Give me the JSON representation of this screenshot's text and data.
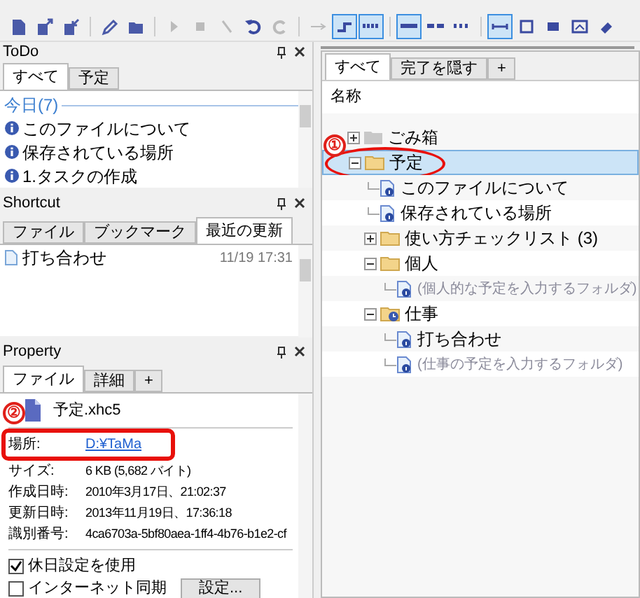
{
  "toolbar": {
    "buttons": [
      {
        "pressed": false
      },
      {
        "pressed": false
      },
      {
        "pressed": false
      },
      {
        "pressed": false
      },
      {
        "pressed": false
      },
      {
        "pressed": false
      },
      {
        "pressed": false
      },
      {
        "pressed": false
      },
      {
        "pressed": false
      },
      {
        "pressed": false
      },
      {
        "pressed": false
      },
      {
        "pressed": true
      },
      {
        "pressed": true
      },
      {
        "pressed": true
      },
      {
        "pressed": false
      },
      {
        "pressed": false
      },
      {
        "pressed": true
      },
      {
        "pressed": false
      },
      {
        "pressed": false
      },
      {
        "pressed": false
      },
      {
        "pressed": false
      }
    ]
  },
  "todo": {
    "title": "ToDo",
    "tabs": [
      {
        "label": "すべて",
        "selected": true
      },
      {
        "label": "予定",
        "selected": false
      }
    ],
    "group": "今日(7)",
    "items": [
      "このファイルについて",
      "保存されている場所",
      "1.タスクの作成"
    ]
  },
  "shortcut": {
    "title": "Shortcut",
    "tabs": [
      {
        "label": "ファイル",
        "selected": false
      },
      {
        "label": "ブックマーク",
        "selected": false
      },
      {
        "label": "最近の更新",
        "selected": true
      }
    ],
    "items": [
      {
        "name": "打ち合わせ",
        "time": "11/19 17:31"
      }
    ]
  },
  "property": {
    "title": "Property",
    "tabs": [
      {
        "label": "ファイル",
        "selected": true
      },
      {
        "label": "詳細",
        "selected": false
      },
      {
        "label": "+",
        "selected": false
      }
    ],
    "file_name": "予定.xhc5",
    "fields": [
      {
        "label": "場所:",
        "value": "D:¥TaMa",
        "kind": "link"
      },
      {
        "label": "サイズ:",
        "value": "6 KB (5,682 バイト)",
        "kind": "text"
      },
      {
        "label": "作成日時:",
        "value": "2010年3月17日、21:02:37",
        "kind": "text"
      },
      {
        "label": "更新日時:",
        "value": "2013年11月19日、17:36:18",
        "kind": "text"
      },
      {
        "label": "識別番号:",
        "value": "4ca6703a-5bf80aea-1ff4-4b76-b1e2-cf",
        "kind": "text"
      }
    ],
    "options": [
      {
        "label": "休日設定を使用",
        "checked": true
      },
      {
        "label": "インターネット同期",
        "checked": false
      }
    ],
    "settings_button": "設定..."
  },
  "tree": {
    "tabs": [
      {
        "label": "すべて",
        "selected": true
      },
      {
        "label": "完了を隠す",
        "selected": false
      },
      {
        "label": "+",
        "selected": false
      }
    ],
    "column": "名称",
    "items": [
      {
        "label": "ごみ箱",
        "kind": "trash",
        "selected": false,
        "dimmed": false,
        "expanded": false
      },
      {
        "label": "予定",
        "kind": "folder",
        "selected": true,
        "dimmed": false,
        "expanded": true,
        "children": [
          {
            "label": "このファイルについて",
            "kind": "task",
            "selected": false,
            "dimmed": false
          },
          {
            "label": "保存されている場所",
            "kind": "task",
            "selected": false,
            "dimmed": false
          },
          {
            "label": "使い方チェックリスト (3)",
            "kind": "folder",
            "selected": false,
            "dimmed": false,
            "expanded": false
          },
          {
            "label": "個人",
            "kind": "folder",
            "selected": false,
            "dimmed": false,
            "expanded": true,
            "children": [
              {
                "label": "(個人的な予定を入力するフォルダ)",
                "kind": "task",
                "selected": false,
                "dimmed": true
              }
            ]
          },
          {
            "label": "仕事",
            "kind": "clockfolder",
            "selected": false,
            "dimmed": false,
            "expanded": true,
            "children": [
              {
                "label": "打ち合わせ",
                "kind": "task",
                "selected": false,
                "dimmed": false
              },
              {
                "label": "(仕事の予定を入力するフォルダ)",
                "kind": "task",
                "selected": false,
                "dimmed": true
              }
            ]
          }
        ]
      }
    ]
  },
  "annotations": [
    "①",
    "②"
  ]
}
